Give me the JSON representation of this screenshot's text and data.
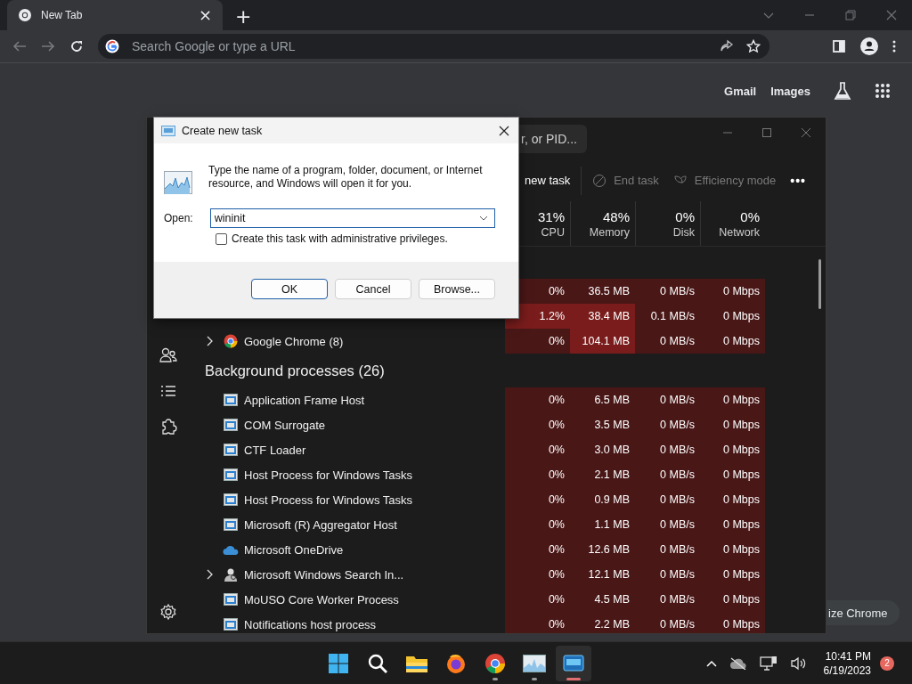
{
  "browser": {
    "tab": {
      "title": "New Tab",
      "close": "×"
    },
    "new_tab": "+",
    "omnibox": {
      "placeholder": "Search Google or type a URL"
    },
    "links": [
      "Gmail",
      "Images"
    ],
    "customize_button": "ize Chrome"
  },
  "task_manager": {
    "search": {
      "placeholder": "r, or PID..."
    },
    "toolbar": [
      {
        "label": "new task",
        "kind": "run",
        "disabled": false
      },
      {
        "label": "End task",
        "kind": "end",
        "disabled": true
      },
      {
        "label": "Efficiency mode",
        "kind": "leaf",
        "disabled": true
      },
      {
        "label": "•••",
        "kind": "more",
        "disabled": false
      }
    ],
    "columns": [
      {
        "percent": "31%",
        "label": "CPU"
      },
      {
        "percent": "48%",
        "label": "Memory"
      },
      {
        "percent": "0%",
        "label": "Disk"
      },
      {
        "percent": "0%",
        "label": "Network"
      }
    ],
    "rows": [
      {
        "kind": "blank"
      },
      {
        "kind": "process",
        "cells": [
          "0%",
          "36.5 MB",
          "0 MB/s",
          "0 Mbps"
        ],
        "hot": [
          false,
          false,
          false,
          false
        ]
      },
      {
        "kind": "process",
        "cells": [
          "1.2%",
          "38.4 MB",
          "0.1 MB/s",
          "0 Mbps"
        ],
        "hot": [
          true,
          true,
          false,
          false
        ]
      },
      {
        "kind": "chrome",
        "name": "Google Chrome (8)",
        "expandable": true,
        "cells": [
          "0%",
          "104.1 MB",
          "0 MB/s",
          "0 Mbps"
        ],
        "hot": [
          false,
          true,
          false,
          false
        ]
      },
      {
        "kind": "section",
        "title": "Background processes (26)"
      },
      {
        "kind": "window",
        "name": "Application Frame Host",
        "expandable": false,
        "cells": [
          "0%",
          "6.5 MB",
          "0 MB/s",
          "0 Mbps"
        ],
        "hot": [
          false,
          false,
          false,
          false
        ]
      },
      {
        "kind": "window",
        "name": "COM Surrogate",
        "expandable": false,
        "cells": [
          "0%",
          "3.5 MB",
          "0 MB/s",
          "0 Mbps"
        ],
        "hot": [
          false,
          false,
          false,
          false
        ]
      },
      {
        "kind": "window",
        "name": "CTF Loader",
        "expandable": false,
        "cells": [
          "0%",
          "3.0 MB",
          "0 MB/s",
          "0 Mbps"
        ],
        "hot": [
          false,
          false,
          false,
          false
        ]
      },
      {
        "kind": "window",
        "name": "Host Process for Windows Tasks",
        "expandable": false,
        "cells": [
          "0%",
          "2.1 MB",
          "0 MB/s",
          "0 Mbps"
        ],
        "hot": [
          false,
          false,
          false,
          false
        ]
      },
      {
        "kind": "window",
        "name": "Host Process for Windows Tasks",
        "expandable": false,
        "cells": [
          "0%",
          "0.9 MB",
          "0 MB/s",
          "0 Mbps"
        ],
        "hot": [
          false,
          false,
          false,
          false
        ]
      },
      {
        "kind": "window",
        "name": "Microsoft (R) Aggregator Host",
        "expandable": false,
        "cells": [
          "0%",
          "1.1 MB",
          "0 MB/s",
          "0 Mbps"
        ],
        "hot": [
          false,
          false,
          false,
          false
        ]
      },
      {
        "kind": "cloud",
        "name": "Microsoft OneDrive",
        "expandable": false,
        "cells": [
          "0%",
          "12.6 MB",
          "0 MB/s",
          "0 Mbps"
        ],
        "hot": [
          false,
          false,
          false,
          false
        ]
      },
      {
        "kind": "search",
        "name": "Microsoft Windows Search In...",
        "expandable": true,
        "cells": [
          "0%",
          "12.1 MB",
          "0 MB/s",
          "0 Mbps"
        ],
        "hot": [
          false,
          false,
          false,
          false
        ]
      },
      {
        "kind": "window",
        "name": "MoUSO Core Worker Process",
        "expandable": false,
        "cells": [
          "0%",
          "4.5 MB",
          "0 MB/s",
          "0 Mbps"
        ],
        "hot": [
          false,
          false,
          false,
          false
        ]
      },
      {
        "kind": "window",
        "name": "Notifications host process",
        "expandable": false,
        "cells": [
          "0%",
          "2.2 MB",
          "0 MB/s",
          "0 Mbps"
        ],
        "hot": [
          false,
          false,
          false,
          false
        ]
      }
    ]
  },
  "dialog": {
    "title": "Create new task",
    "description": "Type the name of a program, folder, document, or Internet resource, and Windows will open it for you.",
    "open_label": "Open:",
    "value": "wininit",
    "checkbox": {
      "label": "Create this task with administrative privileges.",
      "checked": false
    },
    "buttons": [
      {
        "label": "OK",
        "default": true
      },
      {
        "label": "Cancel",
        "default": false
      },
      {
        "label": "Browse...",
        "default": false
      }
    ]
  },
  "taskbar": {
    "pins": [
      {
        "kind": "start",
        "running": false,
        "active": false
      },
      {
        "kind": "search",
        "running": false,
        "active": false
      },
      {
        "kind": "folder",
        "running": false,
        "active": false
      },
      {
        "kind": "firefox",
        "running": false,
        "active": false
      },
      {
        "kind": "chrome",
        "running": true,
        "active": false
      },
      {
        "kind": "monitor",
        "running": true,
        "active": false
      },
      {
        "kind": "runbox",
        "running": true,
        "active": true
      }
    ],
    "time": "10:41 PM",
    "date": "6/19/2023",
    "notifications": "2"
  }
}
